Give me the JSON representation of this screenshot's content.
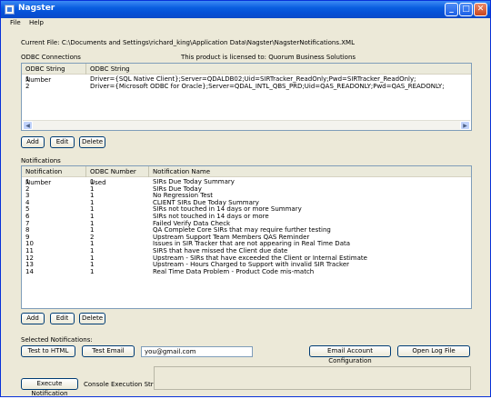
{
  "window": {
    "title": "Nagster",
    "min_glyph": "_",
    "max_glyph": "□",
    "close_glyph": "✕"
  },
  "menu": {
    "file": "File",
    "help": "Help"
  },
  "current_file": "Current File: C:\\Documents and Settings\\richard_king\\Application Data\\Nagster\\NagsterNotifications.XML",
  "license": "This product is licensed to: Quorum Business Solutions",
  "odbc": {
    "section_label": "ODBC Connections",
    "columns": [
      "ODBC String Number",
      "ODBC String"
    ],
    "rows": [
      [
        "1",
        "Driver={SQL Native Client};Server=QDALDB02;Uid=SIRTracker_ReadOnly;Pwd=SIRTracker_ReadOnly;"
      ],
      [
        "2",
        "Driver={Microsoft ODBC for Oracle};Server=QDAL_INTL_QBS_PRD;Uid=QAS_READONLY;Pwd=QAS_READONLY;"
      ]
    ],
    "add": "Add",
    "edit": "Edit",
    "delete": "Delete"
  },
  "notifications": {
    "section_label": "Notifications",
    "columns": [
      "Notification Number",
      "ODBC Number Used",
      "Notification Name"
    ],
    "rows": [
      [
        "1",
        "1",
        "SIRs Due Today Summary"
      ],
      [
        "2",
        "1",
        "SIRs Due Today"
      ],
      [
        "3",
        "1",
        "No Regression Test"
      ],
      [
        "4",
        "1",
        "CLIENT SIRs Due Today Summary"
      ],
      [
        "5",
        "1",
        "SIRs not touched in 14 days or more Summary"
      ],
      [
        "6",
        "1",
        "SIRs not touched in 14 days or more"
      ],
      [
        "7",
        "1",
        "Failed Verify Data Check"
      ],
      [
        "8",
        "1",
        "QA Complete Core SIRs that may require further testing"
      ],
      [
        "9",
        "2",
        "Upstream Support Team Members QAS Reminder"
      ],
      [
        "10",
        "1",
        "Issues in SIR Tracker that are not appearing in Real Time Data"
      ],
      [
        "11",
        "1",
        "SIRS that have missed the Client due date"
      ],
      [
        "12",
        "1",
        "Upstream - SIRs that have exceeded the Client or Internal Estimate"
      ],
      [
        "13",
        "1",
        "Upstream - Hours Charged to Support with invalid SIR Tracker"
      ],
      [
        "14",
        "1",
        "Real Time Data Problem - Product Code mis-match"
      ]
    ],
    "add": "Add",
    "edit": "Edit",
    "delete": "Delete"
  },
  "selected": {
    "label": "Selected Notifications:",
    "test_html": "Test to HTML",
    "test_email": "Test Email",
    "email_value": "you@gmail.com",
    "email_config": "Email Account Configuration",
    "open_log": "Open Log File",
    "execute": "Execute Notification",
    "console_label": "Console Execution String:"
  }
}
